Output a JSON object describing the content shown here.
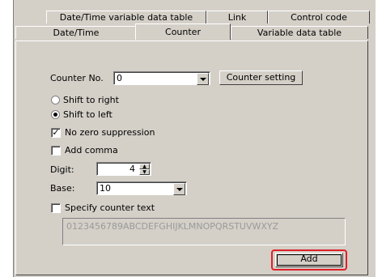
{
  "tabs_row1": [
    "Date/Time variable data table",
    "Link",
    "Control code"
  ],
  "tabs_row2": [
    "Date/Time",
    "Counter",
    "Variable data table"
  ],
  "counter_no": {
    "label": "Counter No.",
    "value": "0",
    "setting_button": "Counter setting"
  },
  "shift": {
    "right_label": "Shift to right",
    "left_label": "Shift to left",
    "selected": "left"
  },
  "options": {
    "no_zero_suppression": "No zero suppression",
    "no_zero_checked": true,
    "add_comma": "Add comma",
    "add_comma_checked": false
  },
  "digit": {
    "label": "Digit:",
    "value": "4"
  },
  "base": {
    "label": "Base:",
    "value": "10"
  },
  "specify_text": {
    "label": "Specify counter text",
    "checked": false,
    "value": "0123456789ABCDEFGHIJKLMNOPQRSTUVWXYZ"
  },
  "add_button": "Add",
  "colors": {
    "highlight": "#e0202a",
    "face": "#d4d0c8"
  }
}
